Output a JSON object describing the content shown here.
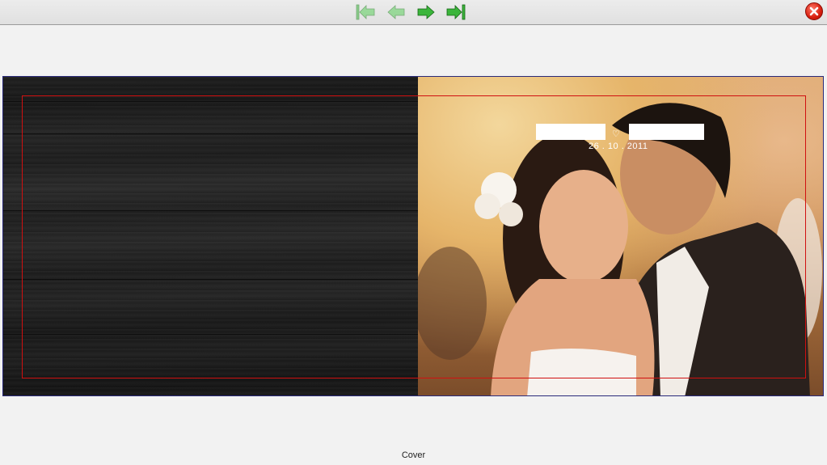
{
  "toolbar": {
    "buttons": [
      {
        "name": "first-page",
        "icon": "first-page-icon",
        "enabled": false
      },
      {
        "name": "previous-page",
        "icon": "arrow-left-icon",
        "enabled": false
      },
      {
        "name": "next-page",
        "icon": "arrow-right-icon",
        "enabled": true
      },
      {
        "name": "last-page",
        "icon": "last-page-icon",
        "enabled": true
      }
    ],
    "close_icon": "close-icon",
    "arrow_color": "#3bb53b",
    "close_color": "#d81e0e"
  },
  "spread": {
    "left_page": "dark wood texture",
    "right_page": "wedding couple photo",
    "guide_color": "#d01010",
    "cover_text": {
      "heart_symbol": "♡",
      "date": "26 . 10 . 2011"
    }
  },
  "page_label": "Cover"
}
